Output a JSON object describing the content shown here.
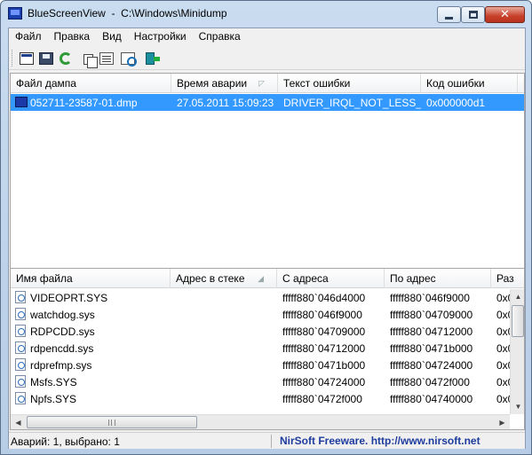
{
  "window": {
    "title": "BlueScreenView  -  C:\\Windows\\Minidump"
  },
  "menu": [
    "Файл",
    "Правка",
    "Вид",
    "Настройки",
    "Справка"
  ],
  "toolbar": {
    "icons": [
      "html-report-icon",
      "save-icon",
      "refresh-icon",
      "copy-icon",
      "properties-icon",
      "find-icon",
      "exit-icon"
    ]
  },
  "top_table": {
    "columns": [
      "Файл дампа",
      "Время аварии",
      "Текст ошибки",
      "Код ошибки",
      "П"
    ],
    "rows": [
      {
        "file": "052711-23587-01.dmp",
        "time": "27.05.2011 15:09:23",
        "error_text": "DRIVER_IRQL_NOT_LESS_O...",
        "error_code": "0x000000d1",
        "selected": true
      }
    ]
  },
  "bottom_table": {
    "columns": [
      "Имя файла",
      "Адрес в стеке",
      "С адреса",
      "По адрес",
      "Раз"
    ],
    "rows": [
      {
        "name": "VIDEOPRT.SYS",
        "stack": "",
        "from": "fffff880`046d4000",
        "to": "fffff880`046f9000",
        "size": "0x0("
      },
      {
        "name": "watchdog.sys",
        "stack": "",
        "from": "fffff880`046f9000",
        "to": "fffff880`04709000",
        "size": "0x0("
      },
      {
        "name": "RDPCDD.sys",
        "stack": "",
        "from": "fffff880`04709000",
        "to": "fffff880`04712000",
        "size": "0x0("
      },
      {
        "name": "rdpencdd.sys",
        "stack": "",
        "from": "fffff880`04712000",
        "to": "fffff880`0471b000",
        "size": "0x0("
      },
      {
        "name": "rdprefmp.sys",
        "stack": "",
        "from": "fffff880`0471b000",
        "to": "fffff880`04724000",
        "size": "0x0("
      },
      {
        "name": "Msfs.SYS",
        "stack": "",
        "from": "fffff880`04724000",
        "to": "fffff880`0472f000",
        "size": "0x0("
      },
      {
        "name": "Npfs.SYS",
        "stack": "",
        "from": "fffff880`0472f000",
        "to": "fffff880`04740000",
        "size": "0x0("
      }
    ]
  },
  "status": {
    "left": "Аварий: 1, выбрано: 1",
    "right": "NirSoft Freeware.  http://www.nirsoft.net"
  },
  "colors": {
    "selection": "#3399ff",
    "link": "#1e3c9e",
    "close_button": "#c7402a"
  }
}
